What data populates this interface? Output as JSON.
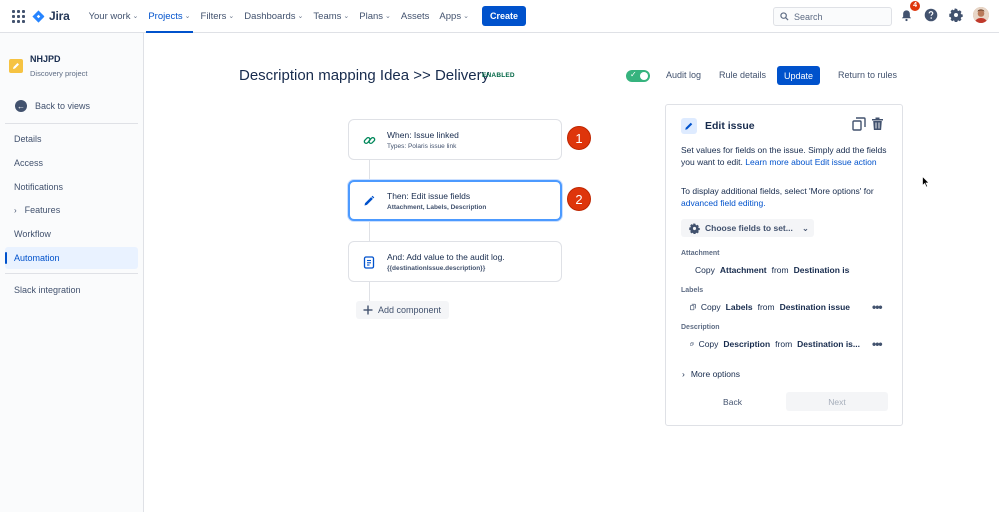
{
  "topnav": {
    "logo": "Jira",
    "items": [
      {
        "label": "Your work",
        "chevron": true,
        "active": false
      },
      {
        "label": "Projects",
        "chevron": true,
        "active": true
      },
      {
        "label": "Filters",
        "chevron": true,
        "active": false
      },
      {
        "label": "Dashboards",
        "chevron": true,
        "active": false
      },
      {
        "label": "Teams",
        "chevron": true,
        "active": false
      },
      {
        "label": "Plans",
        "chevron": true,
        "active": false
      },
      {
        "label": "Assets",
        "chevron": false,
        "active": false
      },
      {
        "label": "Apps",
        "chevron": true,
        "active": false
      }
    ],
    "create_label": "Create",
    "search_placeholder": "Search",
    "notification_count": "4"
  },
  "sidebar": {
    "project_name": "NHJPD",
    "project_type": "Discovery project",
    "back_label": "Back to views",
    "items": [
      "Details",
      "Access",
      "Notifications",
      "Features",
      "Workflow",
      "Automation"
    ],
    "extra_item": "Slack integration"
  },
  "header": {
    "title": "Description mapping Idea >> Delivery",
    "status": "ENABLED",
    "audit_log": "Audit log",
    "rule_details": "Rule details",
    "update": "Update",
    "return": "Return to rules"
  },
  "flow": {
    "trigger": {
      "title": "When: Issue linked",
      "subtitle": "Types: Polaris issue link"
    },
    "action": {
      "title": "Then: Edit issue fields",
      "subtitle": "Attachment, Labels, Description"
    },
    "log": {
      "title": "And: Add value to the audit log.",
      "subtitle": "{{destinationIssue.description}}"
    },
    "add_component": "Add component",
    "badges": [
      "1",
      "2"
    ]
  },
  "panel": {
    "title": "Edit issue",
    "p1_text": "Set values for fields on the issue. Simply add the fields you want to edit. ",
    "p1_link": "Learn more about Edit issue action",
    "p2_text": "To display additional fields, select 'More options' for ",
    "p2_link": "advanced field editing.",
    "choose_fields": "Choose fields to set...",
    "fields": [
      {
        "label": "Attachment",
        "copy": "Copy",
        "field": "Attachment",
        "from": "from",
        "source": "Destination issue"
      },
      {
        "label": "Labels",
        "copy": "Copy",
        "field": "Labels",
        "from": "from",
        "source": "Destination issue"
      },
      {
        "label": "Description",
        "copy": "Copy",
        "field": "Description",
        "from": "from",
        "source": "Destination is..."
      }
    ],
    "more_options": "More options",
    "back": "Back",
    "next": "Next"
  },
  "colors": {
    "brand": "#0052cc",
    "badge": "#de350b",
    "enabled": "#006644",
    "toggle_on": "#36b37e"
  }
}
